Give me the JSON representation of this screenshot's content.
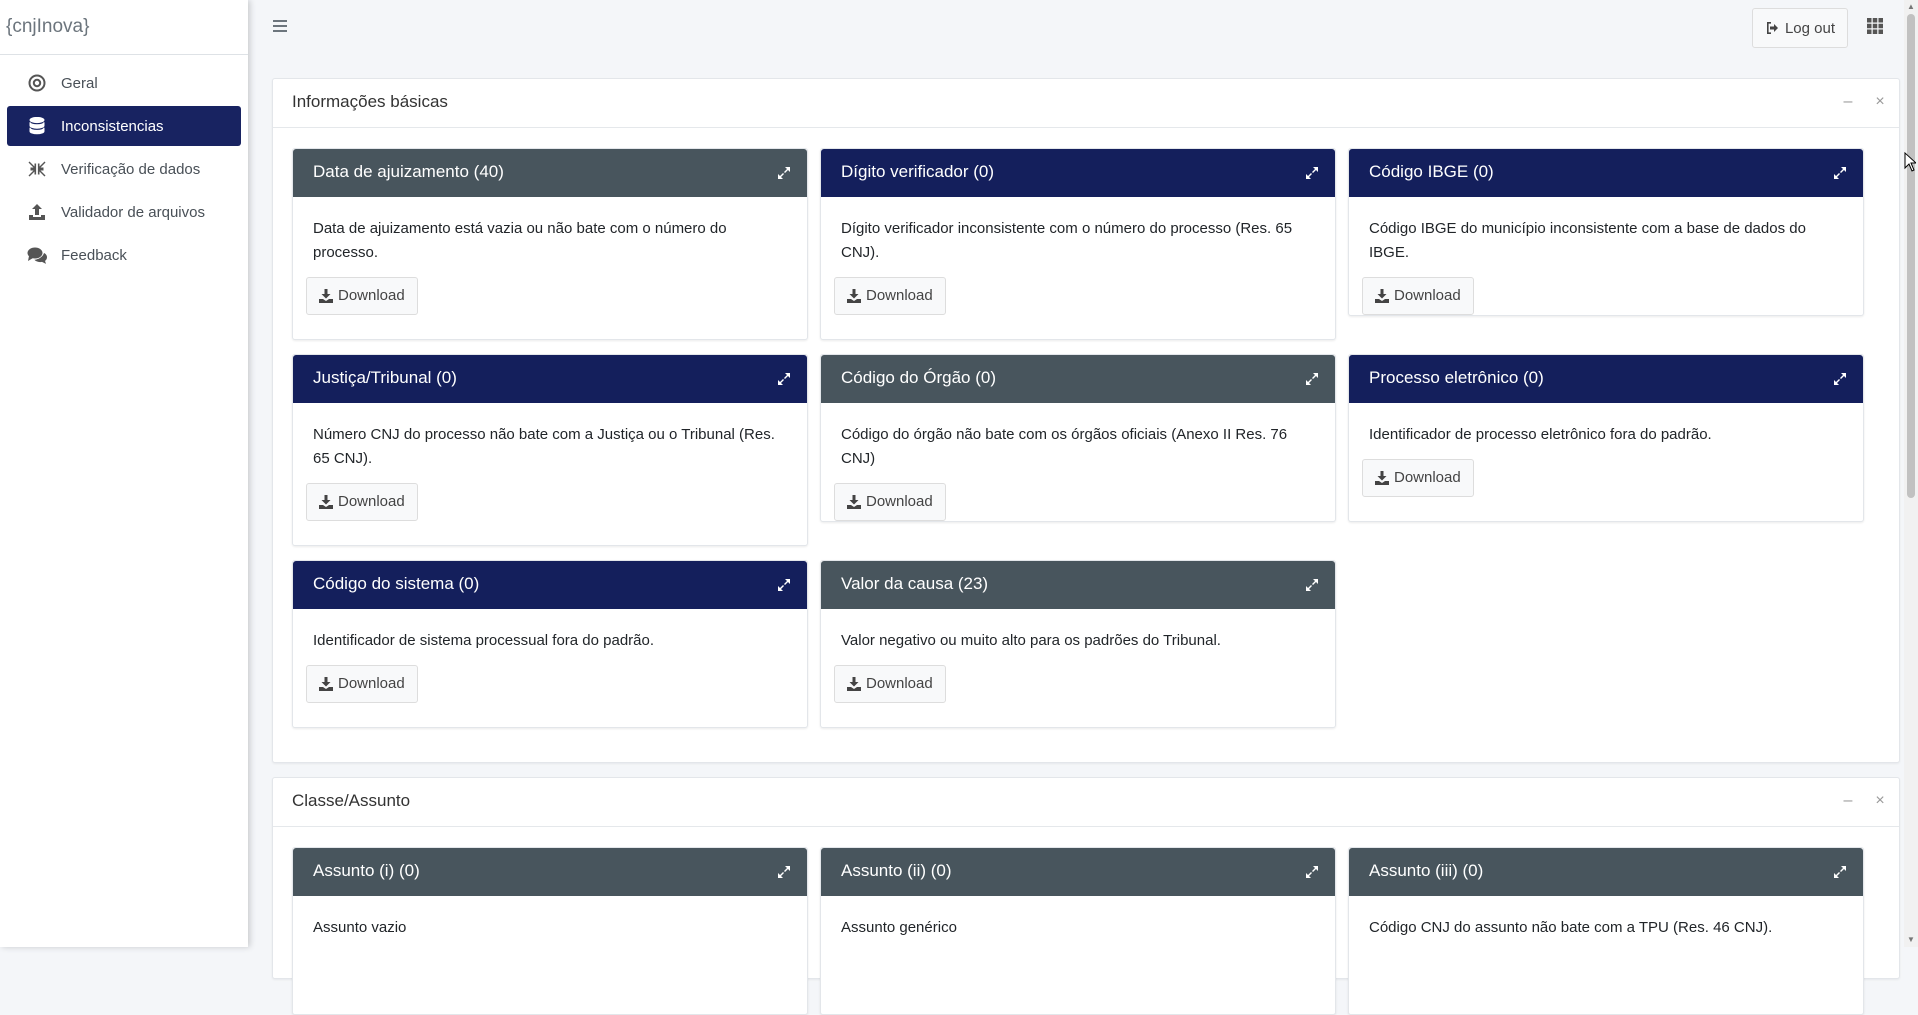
{
  "sidebar": {
    "brand": "{cnjInova}",
    "items": [
      {
        "label": "Geral",
        "icon": "target-icon",
        "active": false
      },
      {
        "label": "Inconsistencias",
        "icon": "database-icon",
        "active": true
      },
      {
        "label": "Verificação de dados",
        "icon": "compress-icon",
        "active": false
      },
      {
        "label": "Validador de arquivos",
        "icon": "upload-icon",
        "active": false
      },
      {
        "label": "Feedback",
        "icon": "comments-icon",
        "active": false
      }
    ]
  },
  "topbar": {
    "logout_label": "Log out"
  },
  "colors": {
    "navy": "#141f5c",
    "slate": "#48555d",
    "active_nav": "#182361"
  },
  "sections": [
    {
      "title": "Informações básicas",
      "cards": [
        {
          "title": "Data de ajuizamento (40)",
          "text": "Data de ajuizamento está vazia ou não bate com o número do processo.",
          "button": "Download",
          "color": "slate"
        },
        {
          "title": "Dígito verificador (0)",
          "text": "Dígito verificador inconsistente com o número do processo (Res. 65 CNJ).",
          "button": "Download",
          "color": "navy"
        },
        {
          "title": "Código IBGE (0)",
          "text": "Código IBGE do município inconsistente com a base de dados do IBGE.",
          "button": "Download",
          "color": "navy"
        },
        {
          "title": "Justiça/Tribunal (0)",
          "text": "Número CNJ do processo não bate com a Justiça ou o Tribunal (Res. 65 CNJ).",
          "button": "Download",
          "color": "navy"
        },
        {
          "title": "Código do Órgão (0)",
          "text": "Código do órgão não bate com os órgãos oficiais (Anexo II Res. 76 CNJ)",
          "button": "Download",
          "color": "slate"
        },
        {
          "title": "Processo eletrônico (0)",
          "text": "Identificador de processo eletrônico fora do padrão.",
          "button": "Download",
          "color": "navy"
        },
        {
          "title": "Código do sistema (0)",
          "text": "Identificador de sistema processual fora do padrão.",
          "button": "Download",
          "color": "navy"
        },
        {
          "title": "Valor da causa (23)",
          "text": "Valor negativo ou muito alto para os padrões do Tribunal.",
          "button": "Download",
          "color": "slate"
        }
      ]
    },
    {
      "title": "Classe/Assunto",
      "cards": [
        {
          "title": "Assunto (i) (0)",
          "text": "Assunto vazio",
          "color": "slate"
        },
        {
          "title": "Assunto (ii) (0)",
          "text": "Assunto genérico",
          "color": "slate"
        },
        {
          "title": "Assunto (iii) (0)",
          "text": "Código CNJ do assunto não bate com a TPU (Res. 46 CNJ).",
          "color": "slate"
        }
      ]
    }
  ]
}
